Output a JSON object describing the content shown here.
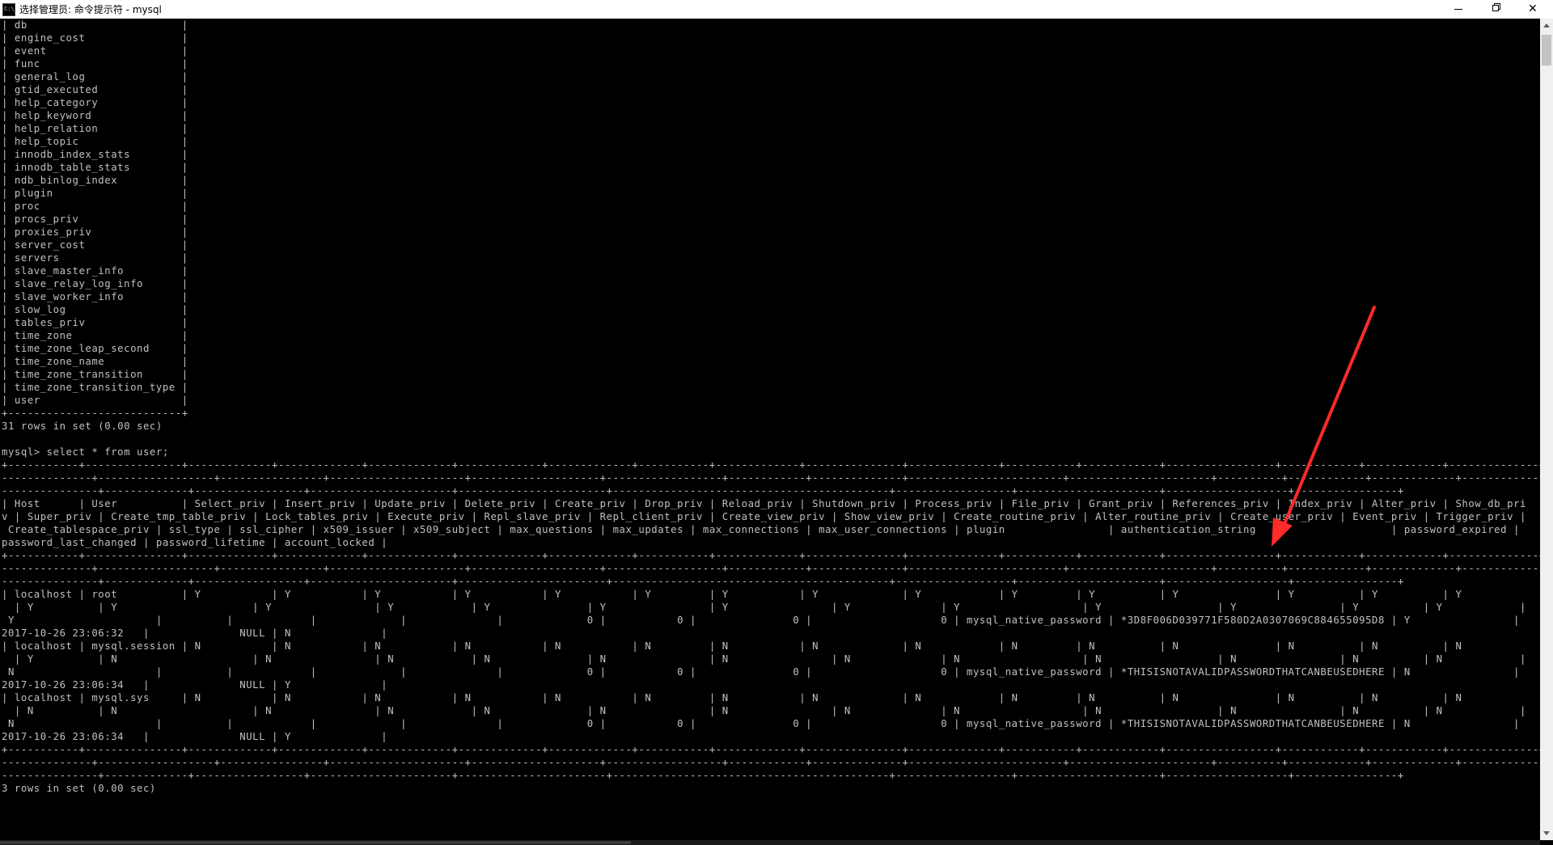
{
  "window": {
    "title": "选择管理员: 命令提示符 - mysql",
    "close_glyph": "✕"
  },
  "console": {
    "lines": [
      "| db                        |",
      "| engine_cost               |",
      "| event                     |",
      "| func                      |",
      "| general_log               |",
      "| gtid_executed             |",
      "| help_category             |",
      "| help_keyword              |",
      "| help_relation             |",
      "| help_topic                |",
      "| innodb_index_stats        |",
      "| innodb_table_stats        |",
      "| ndb_binlog_index          |",
      "| plugin                    |",
      "| proc                      |",
      "| procs_priv                |",
      "| proxies_priv              |",
      "| server_cost               |",
      "| servers                   |",
      "| slave_master_info         |",
      "| slave_relay_log_info      |",
      "| slave_worker_info         |",
      "| slow_log                  |",
      "| tables_priv               |",
      "| time_zone                 |",
      "| time_zone_leap_second     |",
      "| time_zone_name            |",
      "| time_zone_transition      |",
      "| time_zone_transition_type |",
      "| user                      |",
      "+---------------------------+",
      "31 rows in set (0.00 sec)",
      "",
      "mysql> select * from user;",
      "+-----------+---------------+-------------+-------------+-------------+-------------+-------------+-----------+-------------+---------------+--------------+-----------+------------+-----------------+------------+------------+--------------+",
      "--------------+------------------+----------------+---------------------+--------------------+------------------+------------+--------------+------------------------+----------------------+----------+------------+-------------+--------------+",
      "---------------+-------------+-----------------+----------------------+-----------------------+-------------------------------------------+------------------+----------------------+-------------------+----------------+",
      "| Host      | User          | Select_priv | Insert_priv | Update_priv | Delete_priv | Create_priv | Drop_priv | Reload_priv | Shutdown_priv | Process_priv | File_priv | Grant_priv | References_priv | Index_priv | Alter_priv | Show_db_pri",
      "v | Super_priv | Create_tmp_table_priv | Lock_tables_priv | Execute_priv | Repl_slave_priv | Repl_client_priv | Create_view_priv | Show_view_priv | Create_routine_priv | Alter_routine_priv | Create_user_priv | Event_priv | Trigger_priv |",
      " Create_tablespace_priv | ssl_type | ssl_cipher | x509_issuer | x509_subject | max_questions | max_updates | max_connections | max_user_connections | plugin                | authentication_string                     | password_expired |",
      "password_last_changed | password_lifetime | account_locked |",
      "+-----------+---------------+-------------+-------------+-------------+-------------+-------------+-----------+-------------+---------------+--------------+-----------+------------+-----------------+------------+------------+--------------+",
      "--------------+------------------+----------------+---------------------+--------------------+------------------+------------+--------------+------------------------+----------------------+----------+------------+-------------+--------------+",
      "---------------+-------------+-----------------+----------------------+-----------------------+-------------------------------------------+------------------+----------------------+-------------------+----------------+",
      "| localhost | root          | Y           | Y           | Y           | Y           | Y           | Y         | Y           | Y             | Y            | Y         | Y          | Y               | Y          | Y          | Y",
      "  | Y          | Y                     | Y                | Y            | Y               | Y                | Y                | Y              | Y                   | Y                  | Y                | Y          | Y            |",
      " Y                      |          |            |             |              |             0 |           0 |               0 |                    0 | mysql_native_password | *3D8F006D039771F580D2A0307069C884655095D8 | Y                |",
      "2017-10-26 23:06:32   |              NULL | N              |",
      "| localhost | mysql.session | N           | N           | N           | N           | N           | N         | N           | N             | N            | N         | N          | N               | N          | N          | N",
      "  | Y          | N                     | N                | N            | N               | N                | N                | N              | N                   | N                  | N                | N          | N            |",
      " N                      |          |            |             |              |             0 |           0 |               0 |                    0 | mysql_native_password | *THISISNOTAVALIDPASSWORDTHATCANBEUSEDHERE | N                |",
      "2017-10-26 23:06:34   |              NULL | Y              |",
      "| localhost | mysql.sys     | N           | N           | N           | N           | N           | N         | N           | N             | N            | N         | N          | N               | N          | N          | N",
      "  | N          | N                     | N                | N            | N               | N                | N                | N              | N                   | N                  | N                | N          | N            |",
      " N                      |          |            |             |              |             0 |           0 |               0 |                    0 | mysql_native_password | *THISISNOTAVALIDPASSWORDTHATCANBEUSEDHERE | N                |",
      "2017-10-26 23:06:34   |              NULL | Y              |",
      "+-----------+---------------+-------------+-------------+-------------+-------------+-------------+-----------+-------------+---------------+--------------+-----------+------------+-----------------+------------+------------+--------------+",
      "--------------+------------------+----------------+---------------------+--------------------+------------------+------------+--------------+------------------------+----------------------+----------+------------+-------------+--------------+",
      "---------------+-------------+-----------------+----------------------+-----------------------+-------------------------------------------+------------------+----------------------+-------------------+----------------+",
      "3 rows in set (0.00 sec)",
      ""
    ]
  },
  "annotation": {
    "arrow_color": "#ff2a2a"
  }
}
